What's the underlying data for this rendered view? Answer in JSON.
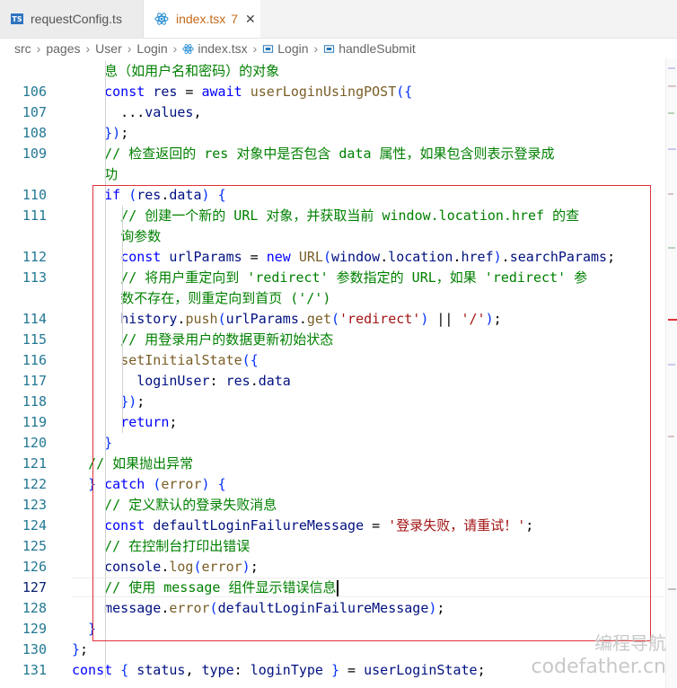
{
  "tabs": [
    {
      "label": "requestConfig.ts",
      "icon": "ts-icon"
    },
    {
      "label": "index.tsx",
      "badge": "7",
      "icon": "react-icon"
    }
  ],
  "breadcrumb": [
    "src",
    "pages",
    "User",
    "Login",
    "index.tsx",
    "Login",
    "handleSubmit"
  ],
  "lines": [
    {
      "n": "",
      "t": "    息（如用户名和密码）的对象"
    },
    {
      "n": "106",
      "t": "    const res = await userLoginUsingPOST({"
    },
    {
      "n": "107",
      "t": "      ...values,"
    },
    {
      "n": "108",
      "t": "    });"
    },
    {
      "n": "109",
      "t": "    // 检查返回的 res 对象中是否包含 data 属性，如果包含则表示登录成"
    },
    {
      "n": "",
      "t": "    功"
    },
    {
      "n": "110",
      "t": "    if (res.data) {"
    },
    {
      "n": "111",
      "t": "      // 创建一个新的 URL 对象，并获取当前 window.location.href 的查"
    },
    {
      "n": "",
      "t": "      询参数"
    },
    {
      "n": "112",
      "t": "      const urlParams = new URL(window.location.href).searchParams;"
    },
    {
      "n": "113",
      "t": "      // 将用户重定向到 'redirect' 参数指定的 URL，如果 'redirect' 参"
    },
    {
      "n": "",
      "t": "      数不存在，则重定向到首页 ('/')"
    },
    {
      "n": "114",
      "t": "      history.push(urlParams.get('redirect') || '/');"
    },
    {
      "n": "115",
      "t": "      // 用登录用户的数据更新初始状态"
    },
    {
      "n": "116",
      "t": "      setInitialState({"
    },
    {
      "n": "117",
      "t": "        loginUser: res.data"
    },
    {
      "n": "118",
      "t": "      });"
    },
    {
      "n": "119",
      "t": "      return;"
    },
    {
      "n": "120",
      "t": "    }"
    },
    {
      "n": "121",
      "t": "  // 如果抛出异常"
    },
    {
      "n": "122",
      "t": "  } catch (error) {"
    },
    {
      "n": "123",
      "t": "    // 定义默认的登录失败消息"
    },
    {
      "n": "124",
      "t": "    const defaultLoginFailureMessage = '登录失败，请重试！';"
    },
    {
      "n": "125",
      "t": "    // 在控制台打印出错误"
    },
    {
      "n": "126",
      "t": "    console.log(error);"
    },
    {
      "n": "127",
      "t": "    // 使用 message 组件显示错误信息"
    },
    {
      "n": "128",
      "t": "    message.error(defaultLoginFailureMessage);"
    },
    {
      "n": "129",
      "t": "  }"
    },
    {
      "n": "130",
      "t": "};"
    },
    {
      "n": "131",
      "t": "const { status, type: loginType } = userLoginState;"
    }
  ],
  "watermark": [
    "编程导航",
    "codefather.cn"
  ]
}
